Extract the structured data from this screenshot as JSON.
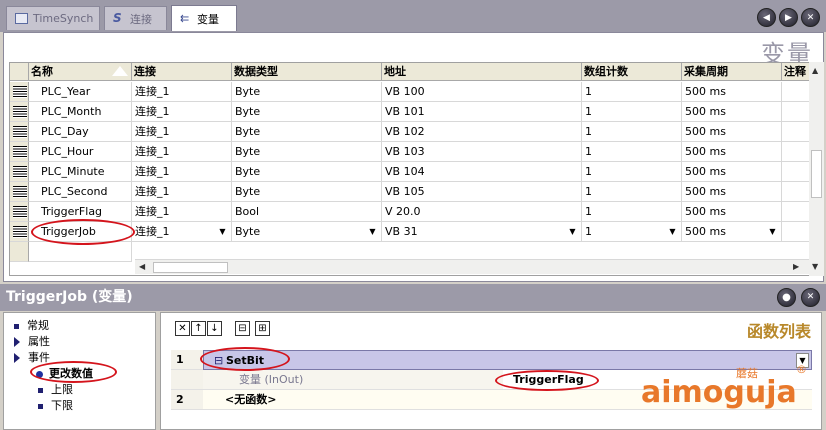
{
  "tabs": [
    {
      "label": "TimeSynch",
      "active": false
    },
    {
      "label": "连接",
      "active": false
    },
    {
      "label": "变量",
      "active": true
    }
  ],
  "watermark": "变量",
  "columns": [
    "名称",
    "连接",
    "数据类型",
    "地址",
    "数组计数",
    "采集周期",
    "注释"
  ],
  "rows": [
    {
      "name": "PLC_Year",
      "connection": "连接_1",
      "type": "Byte",
      "address": "VB 100",
      "count": "1",
      "cycle": "500 ms"
    },
    {
      "name": "PLC_Month",
      "connection": "连接_1",
      "type": "Byte",
      "address": "VB 101",
      "count": "1",
      "cycle": "500 ms"
    },
    {
      "name": "PLC_Day",
      "connection": "连接_1",
      "type": "Byte",
      "address": "VB 102",
      "count": "1",
      "cycle": "500 ms"
    },
    {
      "name": "PLC_Hour",
      "connection": "连接_1",
      "type": "Byte",
      "address": "VB 103",
      "count": "1",
      "cycle": "500 ms"
    },
    {
      "name": "PLC_Minute",
      "connection": "连接_1",
      "type": "Byte",
      "address": "VB 104",
      "count": "1",
      "cycle": "500 ms"
    },
    {
      "name": "PLC_Second",
      "connection": "连接_1",
      "type": "Byte",
      "address": "VB 105",
      "count": "1",
      "cycle": "500 ms"
    },
    {
      "name": "TriggerFlag",
      "connection": "连接_1",
      "type": "Bool",
      "address": "V 20.0",
      "count": "1",
      "cycle": "500 ms"
    },
    {
      "name": "TriggerJob",
      "connection": "连接_1",
      "type": "Byte",
      "address": "VB 31",
      "count": "1",
      "cycle": "500 ms"
    }
  ],
  "props_title": "TriggerJob (变量)",
  "tree": {
    "general": "常规",
    "properties": "属性",
    "events": "事件",
    "change_value": "更改数值",
    "upper_limit": "上限",
    "lower_limit": "下限"
  },
  "func_title": "函数列表",
  "functions": [
    {
      "index": "1",
      "name": "SetBit"
    },
    {
      "index": "2",
      "name": "<无函数>"
    }
  ],
  "param_label": "变量 (InOut)",
  "param_value": "TriggerFlag",
  "logo": {
    "text": "aimoguja",
    "cn": "蘑菇",
    "reg": "®"
  },
  "colors": {
    "accent": "#9c9aa8",
    "highlight_row": "#c8c6e8",
    "annotation": "#d4141c",
    "func_title": "#b8882a"
  }
}
